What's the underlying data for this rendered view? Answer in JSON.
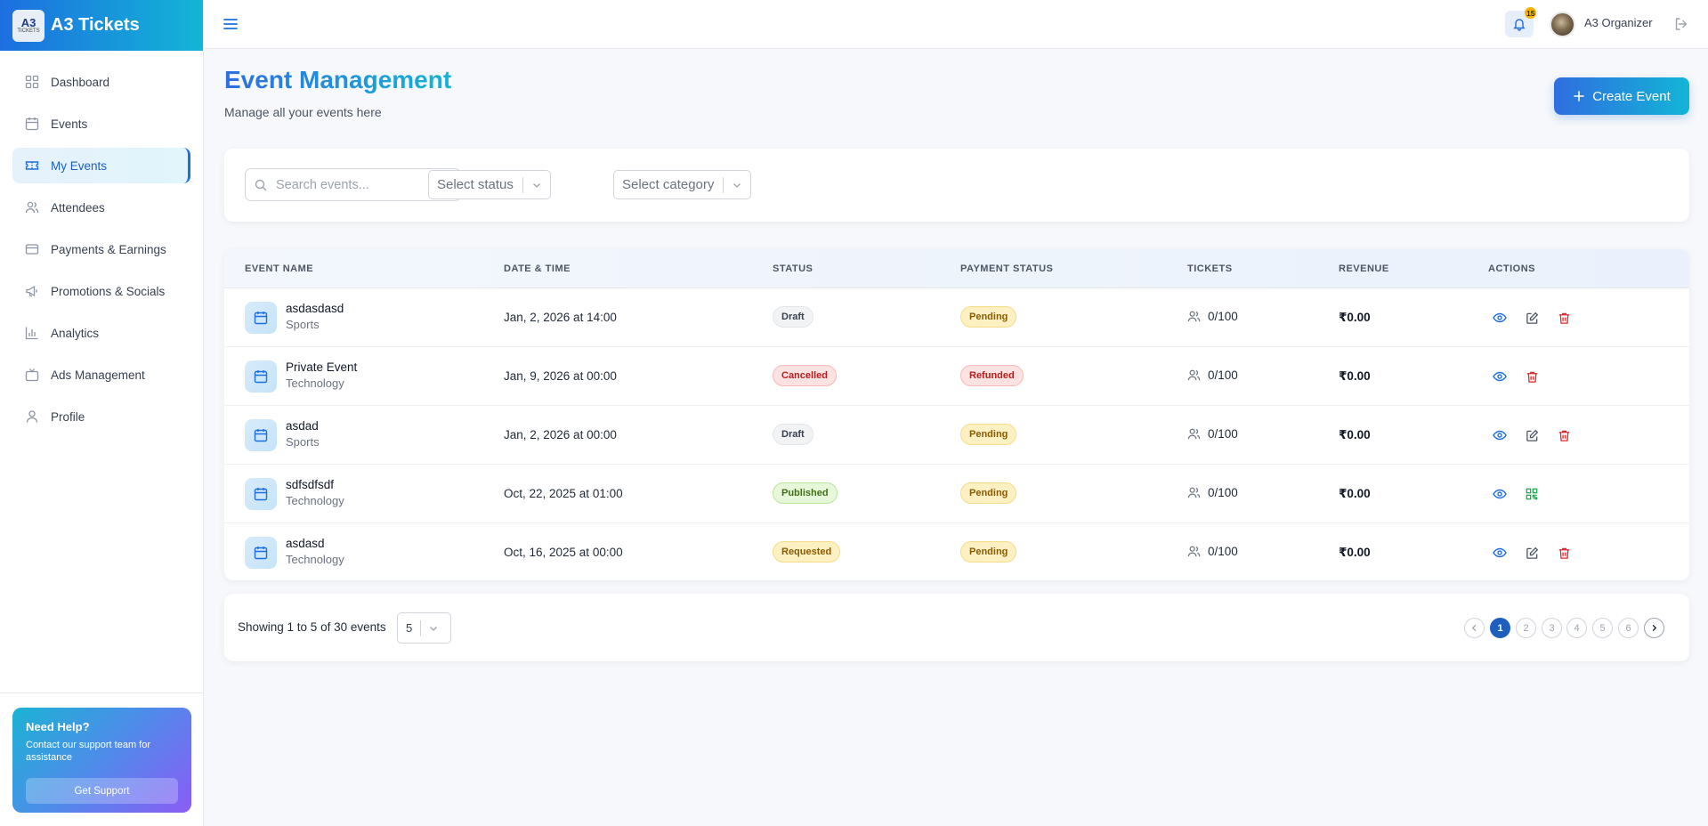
{
  "brand": {
    "logo_text": "A3",
    "logo_sub": "TICKETS",
    "title": "A3 Tickets"
  },
  "sidebar": {
    "items": [
      {
        "label": "Dashboard",
        "icon": "grid-icon"
      },
      {
        "label": "Events",
        "icon": "calendar-icon"
      },
      {
        "label": "My Events",
        "icon": "ticket-icon",
        "active": true
      },
      {
        "label": "Attendees",
        "icon": "users-icon"
      },
      {
        "label": "Payments & Earnings",
        "icon": "credit-card-icon"
      },
      {
        "label": "Promotions & Socials",
        "icon": "megaphone-icon"
      },
      {
        "label": "Analytics",
        "icon": "bar-chart-icon"
      },
      {
        "label": "Ads Management",
        "icon": "tv-icon"
      },
      {
        "label": "Profile",
        "icon": "user-icon"
      }
    ],
    "help": {
      "title": "Need Help?",
      "text": "Contact our support team for assistance",
      "button": "Get Support"
    }
  },
  "topbar": {
    "notification_count": "15",
    "user_name": "A3 Organizer"
  },
  "main": {
    "title": "Event Management",
    "subtitle": "Manage all your events here",
    "create_button": "Create Event"
  },
  "filters": {
    "search_placeholder": "Search events...",
    "status_placeholder": "Select status",
    "category_placeholder": "Select category"
  },
  "table": {
    "columns": [
      "EVENT NAME",
      "DATE & TIME",
      "STATUS",
      "PAYMENT STATUS",
      "TICKETS",
      "REVENUE",
      "ACTIONS"
    ],
    "rows": [
      {
        "name": "asdasdasd",
        "category": "Sports",
        "date": "Jan, 2, 2026 at 14:00",
        "status": "Draft",
        "payment": "Pending",
        "tickets": "0/100",
        "revenue": "₹0.00"
      },
      {
        "name": "Private Event",
        "category": "Technology",
        "date": "Jan, 9, 2026 at 00:00",
        "status": "Cancelled",
        "payment": "Refunded",
        "tickets": "0/100",
        "revenue": "₹0.00"
      },
      {
        "name": "asdad",
        "category": "Sports",
        "date": "Jan, 2, 2026 at 00:00",
        "status": "Draft",
        "payment": "Pending",
        "tickets": "0/100",
        "revenue": "₹0.00"
      },
      {
        "name": "sdfsdfsdf",
        "category": "Technology",
        "date": "Oct, 22, 2025 at 01:00",
        "status": "Published",
        "payment": "Pending",
        "tickets": "0/100",
        "revenue": "₹0.00"
      },
      {
        "name": "asdasd",
        "category": "Technology",
        "date": "Oct, 16, 2025 at 00:00",
        "status": "Requested",
        "payment": "Pending",
        "tickets": "0/100",
        "revenue": "₹0.00"
      }
    ]
  },
  "pagination": {
    "showing_text": "Showing 1 to 5 of 30 events",
    "page_size": "5",
    "pages": [
      "1",
      "2",
      "3",
      "4",
      "5",
      "6"
    ],
    "current_page": "1"
  },
  "colors": {
    "accent": "#1d6fe0",
    "accent_cyan": "#13b5d6",
    "draft": "#f1f3f5",
    "cancelled": "#fde2e2",
    "published": "#e6f8d9",
    "pending": "#fdf1c4"
  }
}
